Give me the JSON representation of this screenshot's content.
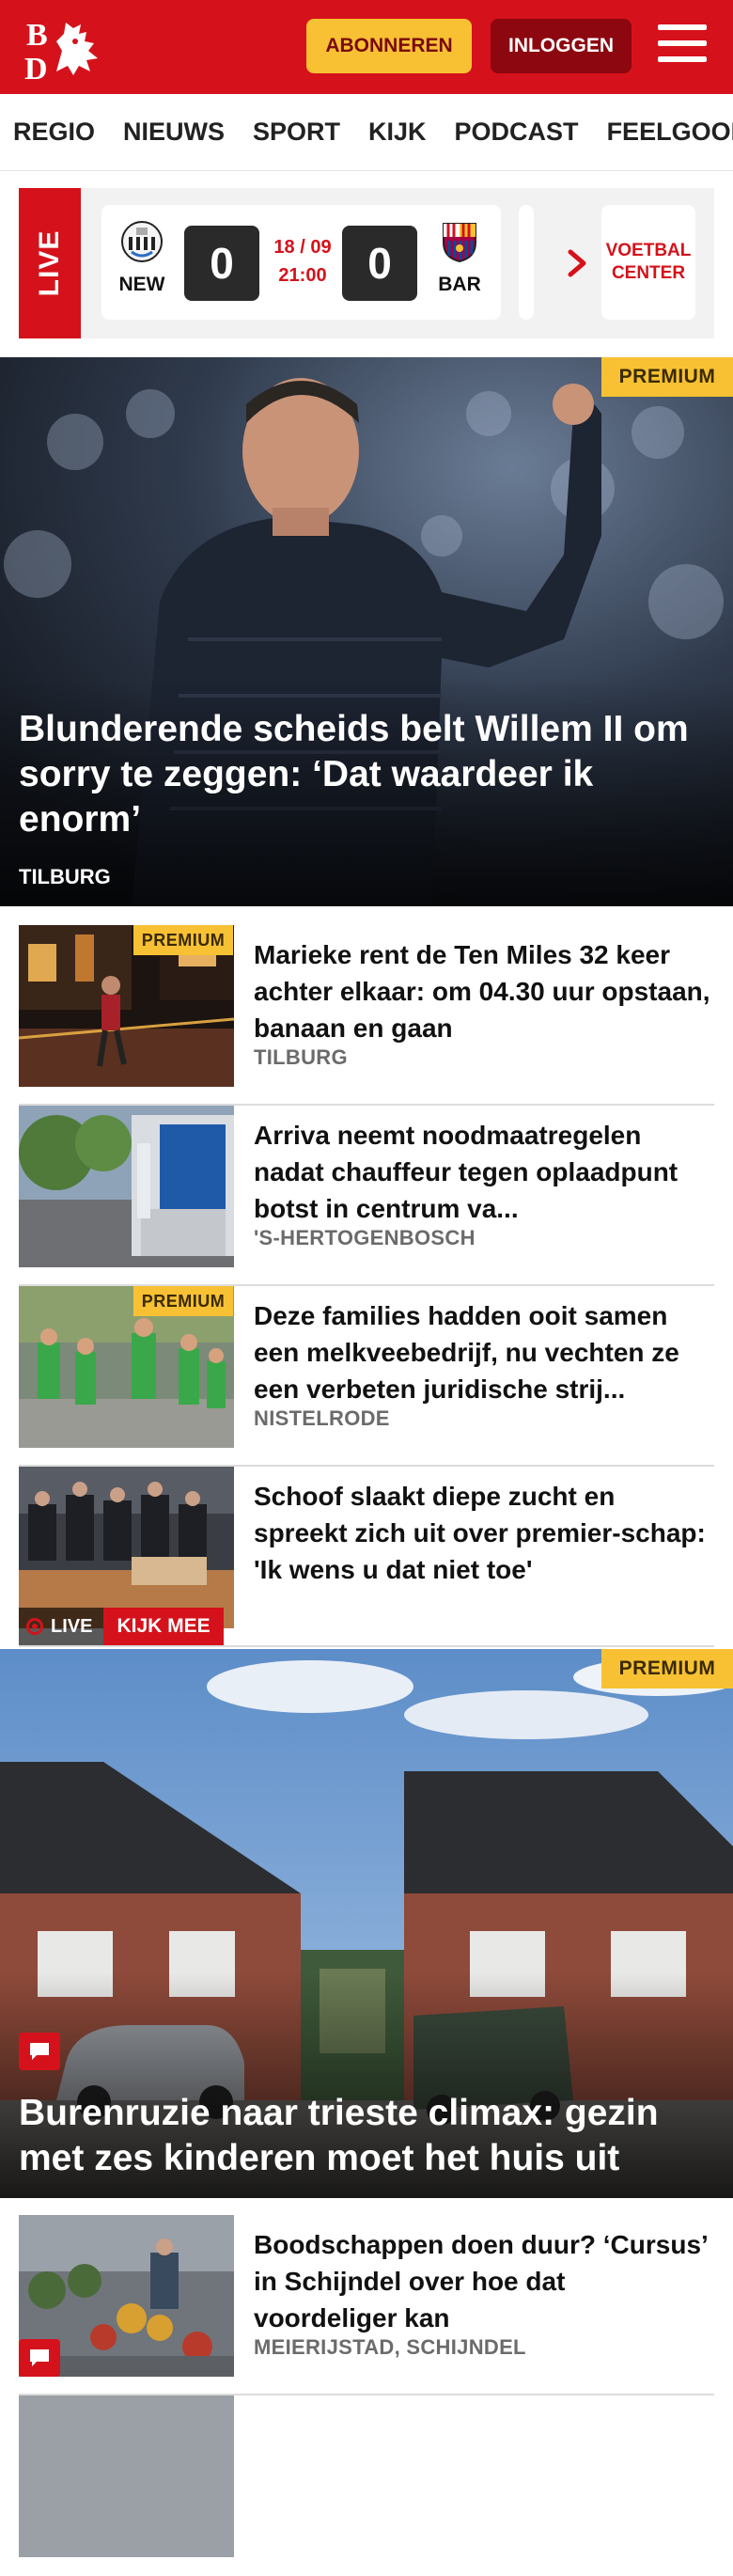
{
  "header": {
    "logo_text": "BD",
    "subscribe_label": "ABONNEREN",
    "login_label": "INLOGGEN",
    "menu_icon": "hamburger-icon",
    "brand_color": "#d5121b"
  },
  "nav": {
    "items": [
      "REGIO",
      "NIEUWS",
      "SPORT",
      "KIJK",
      "PODCAST",
      "FEELGOOD"
    ]
  },
  "livebar": {
    "live_label": "LIVE",
    "match": {
      "home_abbr": "NEW",
      "home_score": "0",
      "date": "18 / 09",
      "time": "21:00",
      "away_score": "0",
      "away_abbr": "BAR"
    },
    "voetbal_center_label": "VOETBAL CENTER"
  },
  "hero1": {
    "premium_label": "PREMIUM",
    "title": "Blunderende scheids belt Willem II om sorry te zeggen: ‘Dat waardeer ik enorm’",
    "tag": "TILBURG"
  },
  "articles": [
    {
      "title": "Marieke rent de Ten Miles 32 keer achter elkaar: om 04.30 uur opstaan, banaan en gaan",
      "tag": "TILBURG",
      "premium_label": "PREMIUM"
    },
    {
      "title": "Arriva neemt noodmaatregelen nadat chauffeur tegen oplaadpunt botst in centrum va...",
      "tag": "'S-HERTOGENBOSCH"
    },
    {
      "title": "Deze families hadden ooit samen een melkveebedrijf, nu vechten ze een verbeten juridische strij...",
      "tag": "NISTELRODE",
      "premium_label": "PREMIUM"
    },
    {
      "title": "Schoof slaakt diepe zucht en spreekt zich uit over premier-schap: 'Ik wens u dat niet toe'",
      "live_label": "LIVE",
      "watch_label": "KIJK MEE"
    }
  ],
  "hero2": {
    "premium_label": "PREMIUM",
    "title": "Burenruzie naar trieste climax: gezin met zes kinderen moet het huis uit"
  },
  "articles2": [
    {
      "title": "Boodschappen doen duur? ‘Cursus’ in Schijndel over hoe dat voordeliger kan",
      "tag": "MEIERIJSTAD, SCHIJNDEL"
    }
  ]
}
